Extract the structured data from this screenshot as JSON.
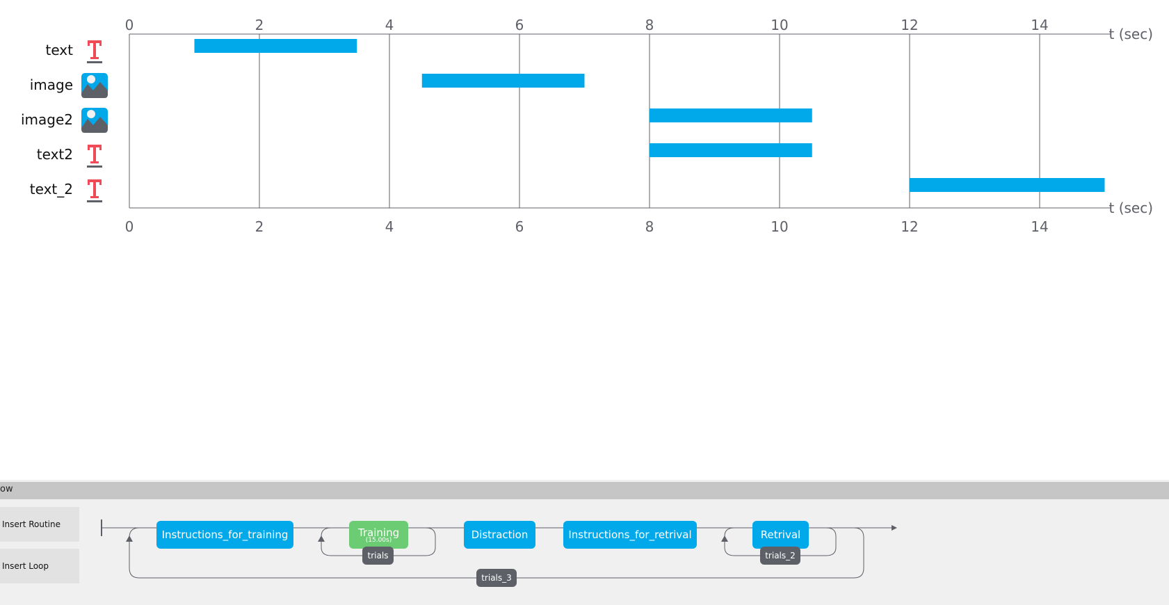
{
  "timeline": {
    "axis_unit_label": "t (sec)",
    "ticks": [
      "0",
      "2",
      "4",
      "6",
      "8",
      "10",
      "12",
      "14"
    ],
    "components": [
      {
        "name": "text",
        "icon": "text-icon",
        "start": 1.0,
        "end": 3.5
      },
      {
        "name": "image",
        "icon": "image-icon",
        "start": 4.5,
        "end": 7.0
      },
      {
        "name": "image2",
        "icon": "image-icon",
        "start": 8.0,
        "end": 10.5
      },
      {
        "name": "text2",
        "icon": "text-icon",
        "start": 8.0,
        "end": 10.5
      },
      {
        "name": "text_2",
        "icon": "text-icon",
        "start": 12.0,
        "end": 15.0
      }
    ],
    "bar_color": "#02a9ea",
    "text_icon_color": "#ef4c58",
    "image_icon_color": "#02a9ea"
  },
  "flow": {
    "header_label": "ow",
    "insert_routine_label": "Insert Routine",
    "insert_loop_label": "Insert Loop",
    "routines": [
      {
        "label": "Instructions_for_training",
        "color": "#02a9ea"
      },
      {
        "label": "Training",
        "sublabel": "(15.00s)",
        "color": "#6ccc74"
      },
      {
        "label": "Distraction",
        "color": "#02a9ea"
      },
      {
        "label": "Instructions_for_retrival",
        "color": "#02a9ea"
      },
      {
        "label": "Retrival",
        "color": "#02a9ea"
      }
    ],
    "loops": [
      {
        "label": "trials"
      },
      {
        "label": "trials_2"
      },
      {
        "label": "trials_3"
      }
    ]
  }
}
